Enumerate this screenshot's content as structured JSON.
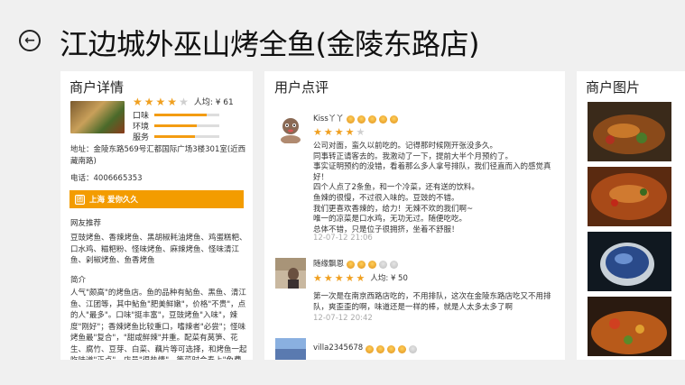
{
  "header": {
    "back_icon": "back-arrow-icon",
    "title": "江边城外巫山烤全鱼(金陵东路店)"
  },
  "merchant": {
    "section_title": "商户详情",
    "rating": 4,
    "avg_price": "人均: ¥ 61",
    "scores": [
      {
        "label": "口味",
        "level": 0.8
      },
      {
        "label": "环境",
        "level": 0.65
      },
      {
        "label": "服务",
        "level": 0.62
      }
    ],
    "address": "地址：金陵东路569号汇都国际广场3楼301室(近西藏南路)",
    "phone": "电话：4006665353",
    "promo": {
      "icon": "ticket-icon",
      "text": "上海 爱你久久"
    },
    "recommend_label": "网友推荐",
    "recommend_text": "豆豉烤鱼、香辣烤鱼、黑胡椒耗油烤鱼、鸡蛋糕粑、口水鸡、糍粑粉、怪味烤鱼、麻辣烤鱼、怪味清江鱼、剁椒烤鱼、鱼香烤鱼",
    "intro_label": "简介",
    "intro_text": "人气\"颇高\"的烤鱼店。鱼的品种有鲇鱼、黑鱼、清江鱼、江团等，其中鲇鱼\"肥美鲜嫩\"，价格\"不贵\"，点的人\"最多\"。口味\"挺丰富\"，豆豉烤鱼\"入味\"，辣度\"刚好\"；香辣烤鱼比较重口，嗜辣者\"必尝\"；怪味烤鱼最\"复合\"，\"甜咸鲜辣\"并重。配菜有莴笋、花生、腐竹、豆芽、白菜、藕片等可选择，和烤鱼一起吃味道\"正点\"。店员\"很热情\"，等菜时会奉上\"免费茶水"
  },
  "reviews": {
    "section_title": "用户点评",
    "items": [
      {
        "user": "Kiss丫丫",
        "medals": 5,
        "rating": 4,
        "avg": "",
        "text": "公司对面，蛮久以前吃的。记得那时候刚开张没多久。\n同事转正请客去的。我激动了一下，提前大半个月预约了。\n事实证明预约的没错，看着那么多人拿号排队，我们径直而入的感觉真好！\n四个人点了2条鱼，和一个冷菜，还有送的饮料。\n鱼辣的很慢，不过很入味的。豆豉的不错。\n我们更喜欢香辣的，给力！无辣不欢的我们啊~\n唯一的凉菜是口水鸡，无功无过。随便吃吃。\n总体不错，只是位子很拥挤，坐着不舒服！",
        "time": "12-07-12 21:06"
      },
      {
        "user": "随缘飘恩",
        "medals": 3,
        "rating": 5,
        "avg": "人均: ¥ 50",
        "text": "第一次是在南京西路店吃的，不用排队，这次在金陵东路店吃又不用排队，爽歪歪的啊，味道还是一样的棒，就是人太多太多了啊",
        "time": "12-07-12 20:42"
      },
      {
        "user": "villa2345678",
        "medals": 4,
        "rating": 0,
        "avg": "",
        "text": "",
        "time": ""
      }
    ]
  },
  "photos": {
    "section_title": "商户图片"
  },
  "colors": {
    "accent_orange": "#f39c00",
    "star": "#f0a020",
    "background": "#f0f0f0"
  }
}
